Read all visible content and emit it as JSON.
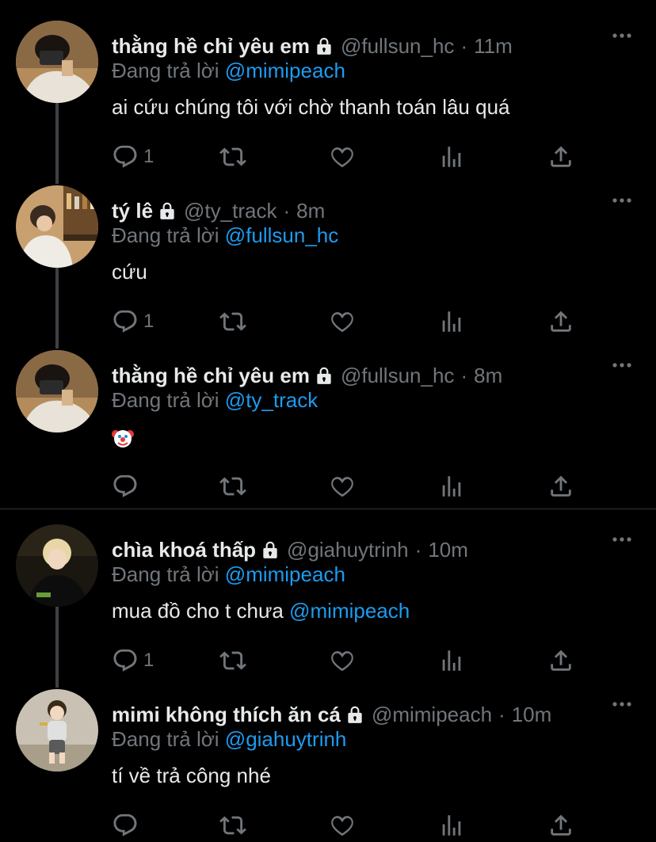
{
  "colors": {
    "background": "#000000",
    "text": "#e7e9ea",
    "muted": "#71767b",
    "link": "#1d9bf0",
    "divider": "#2f3336",
    "thread_line": "#3e4144"
  },
  "icons": {
    "reply": "speech-bubble-icon",
    "retweet": "retweet-icon",
    "like": "heart-icon",
    "stats": "bar-chart-icon",
    "share": "share-upload-icon",
    "more": "more-dots-icon",
    "lock": "lock-icon"
  },
  "tweets": [
    {
      "name": "thằng hề chỉ yêu em",
      "handle": "@fullsun_hc",
      "separator": "·",
      "time": "11m",
      "reply_prefix": "Đang trả lời",
      "reply_to": "@mimipeach",
      "text": "ai cứu chúng tôi với chờ thanh toán lâu quá",
      "reply_count": "1",
      "avatar": "person-with-camera-avatar"
    },
    {
      "name": "tý lê",
      "handle": "@ty_track",
      "separator": "·",
      "time": "8m",
      "reply_prefix": "Đang trả lời",
      "reply_to": "@fullsun_hc",
      "text": "cứu",
      "reply_count": "1",
      "avatar": "person-at-bar-avatar"
    },
    {
      "name": "thằng hề chỉ yêu em",
      "handle": "@fullsun_hc",
      "separator": "·",
      "time": "8m",
      "reply_prefix": "Đang trả lời",
      "reply_to": "@ty_track",
      "text": "",
      "emoji": "clown-face-emoji",
      "reply_count": "",
      "avatar": "person-with-camera-avatar"
    },
    {
      "name": "chìa khoá thấp",
      "handle": "@giahuytrinh",
      "separator": "·",
      "time": "10m",
      "reply_prefix": "Đang trả lời",
      "reply_to": "@mimipeach",
      "text": "mua đồ cho t chưa",
      "text_mention": "@mimipeach",
      "reply_count": "1",
      "avatar": "blond-person-avatar"
    },
    {
      "name": "mimi không thích ăn cá",
      "handle": "@mimipeach",
      "separator": "·",
      "time": "10m",
      "reply_prefix": "Đang trả lời",
      "reply_to": "@giahuytrinh",
      "text": "tí về trả công nhé",
      "reply_count": "",
      "avatar": "toddler-avatar"
    }
  ]
}
